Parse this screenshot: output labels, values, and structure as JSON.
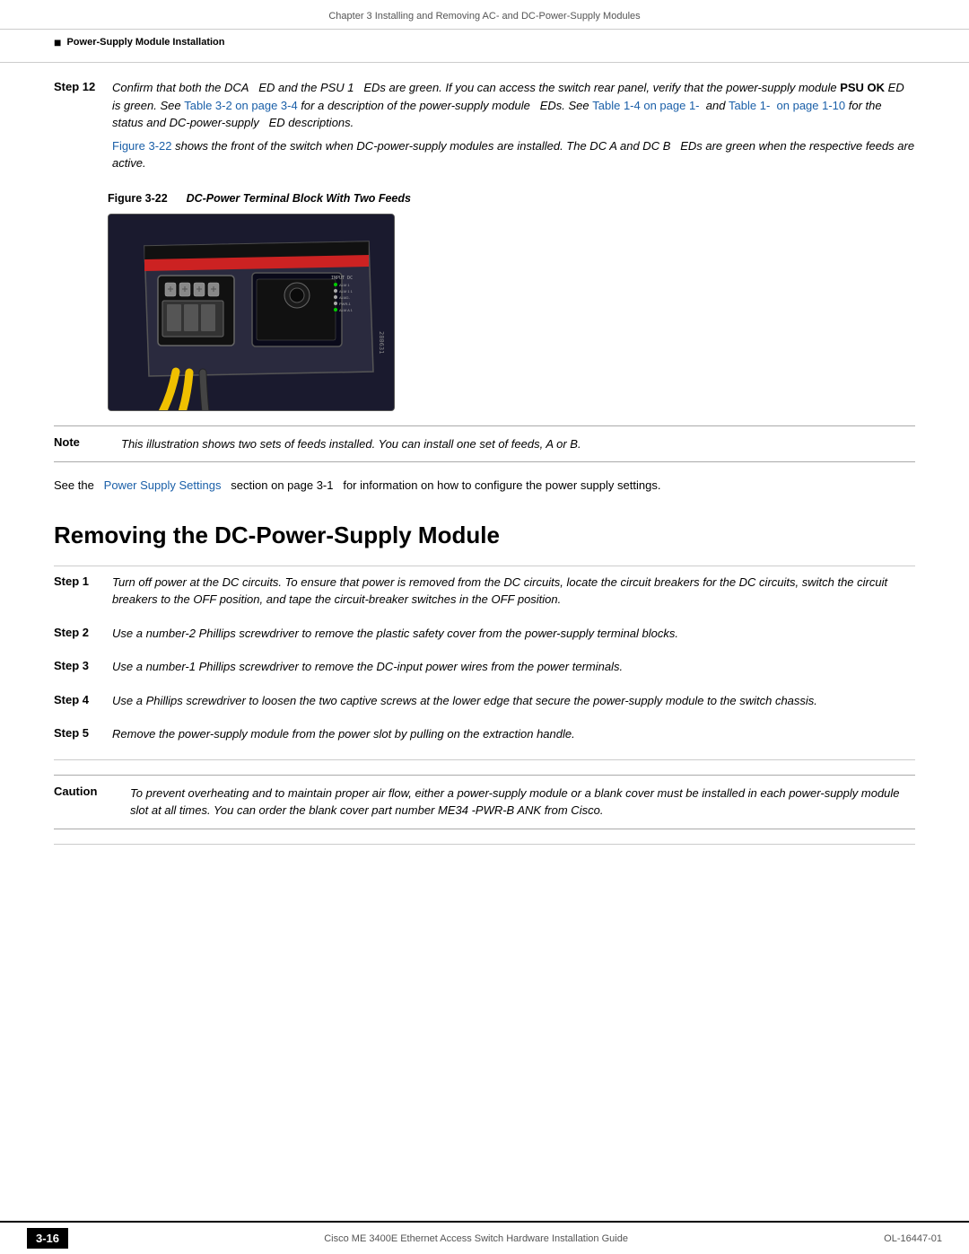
{
  "header": {
    "left": "",
    "center": "Chapter 3    Installing and Removing AC- and DC-Power-Supply Modules",
    "right": ""
  },
  "breadcrumb": "Power-Supply Module Installation",
  "step12": {
    "label": "Step 12",
    "text1": "Confirm that both the DCA",
    "text1b": "ED and the PSU 1",
    "text1c": "EDs are green.  If you can access the switch rear panel, verify that the power-supply module",
    "psuok": "PSU OK",
    "text1d": "ED is green.  See",
    "link1": "Table 3-2 on page 3-4",
    "text1e": "for a description of the power-supply module",
    "text1f": "EDs. See",
    "link2": "Table 1-4 on page 1-",
    "text1g": "and",
    "link3": "Table 1-",
    "text1h": "on page 1-10",
    "text1i": "for the status and DC-power-supply",
    "text1j": "ED descriptions.",
    "para2a": "Figure 3-22",
    "para2b": "shows the front of the switch when DC-power-supply modules are installed. The DC A and DC B",
    "para2c": "EDs are green when the respective feeds are active."
  },
  "figure": {
    "number": "Figure 3-22",
    "caption": "DC-Power Terminal Block With Two Feeds",
    "serial": "280631"
  },
  "note": {
    "label": "Note",
    "text": "This illustration shows two sets of feeds installed. You can install one set of feeds, A or B."
  },
  "see_line": {
    "text1": "See the ",
    "link": "Power Supply Settings",
    "text2": "section on page 3-1",
    "text3": "for information on how to configure the power supply settings."
  },
  "section_heading": "Removing the DC-Power-Supply Module",
  "steps": [
    {
      "label": "Step 1",
      "text": "Turn off power at the DC circuits. To ensure that power is removed from the DC circuits, locate the circuit breakers for the DC circuits, switch the circuit breakers to the OFF position, and tape the circuit-breaker switches in the OFF position."
    },
    {
      "label": "Step 2",
      "text": "Use a number-2 Phillips screwdriver to remove the plastic safety cover from the power-supply terminal blocks."
    },
    {
      "label": "Step 3",
      "text": "Use a number-1 Phillips screwdriver to remove the DC-input power wires from the power terminals."
    },
    {
      "label": "Step 4",
      "text": "Use a Phillips screwdriver to loosen the two captive screws at the lower edge that secure the power-supply module to the switch chassis."
    },
    {
      "label": "Step 5",
      "text": "Remove the power-supply module from the power slot by pulling on the extraction handle."
    }
  ],
  "caution": {
    "label": "Caution",
    "text": "To prevent overheating and to maintain proper air flow, either a power-supply module or a blank cover must be installed in each power-supply module slot at all times. You can order the blank cover  part number ME34  -PWR-B  ANK     from Cisco."
  },
  "footer": {
    "page_num": "3-16",
    "center": "Cisco ME 3400E Ethernet Access Switch Hardware Installation Guide",
    "right": "OL-16447-01"
  }
}
